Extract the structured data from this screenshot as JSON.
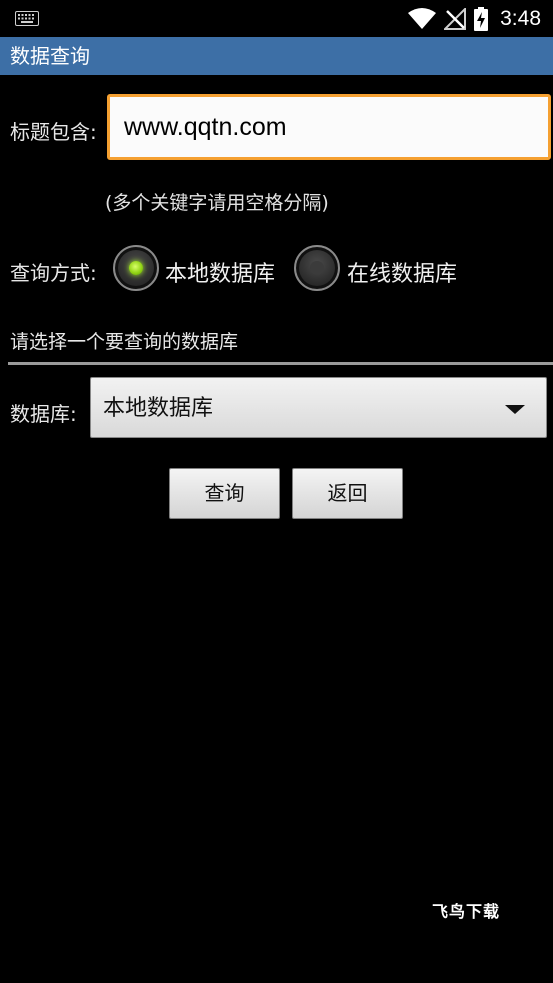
{
  "status_bar": {
    "time": "3:48",
    "icons": [
      "keyboard-icon",
      "wifi-icon",
      "no-signal-icon",
      "battery-charging-icon"
    ]
  },
  "app": {
    "title": "数据查询"
  },
  "form": {
    "title_label": "标题包含:",
    "title_value": "www.qqtn.com",
    "hint": "(多个关键字请用空格分隔)",
    "mode_label": "查询方式:",
    "mode_options": [
      {
        "label": "本地数据库",
        "checked": true
      },
      {
        "label": "在线数据库",
        "checked": false
      }
    ],
    "section_title": "请选择一个要查询的数据库",
    "db_label": "数据库:",
    "db_selected": "本地数据库",
    "query_button": "查询",
    "back_button": "返回"
  },
  "watermark": "飞鸟下载",
  "colors": {
    "title_bar": "#3d6fa6",
    "input_focus_border": "#f5a031",
    "radio_checked": "#93d416",
    "background": "#000000"
  }
}
